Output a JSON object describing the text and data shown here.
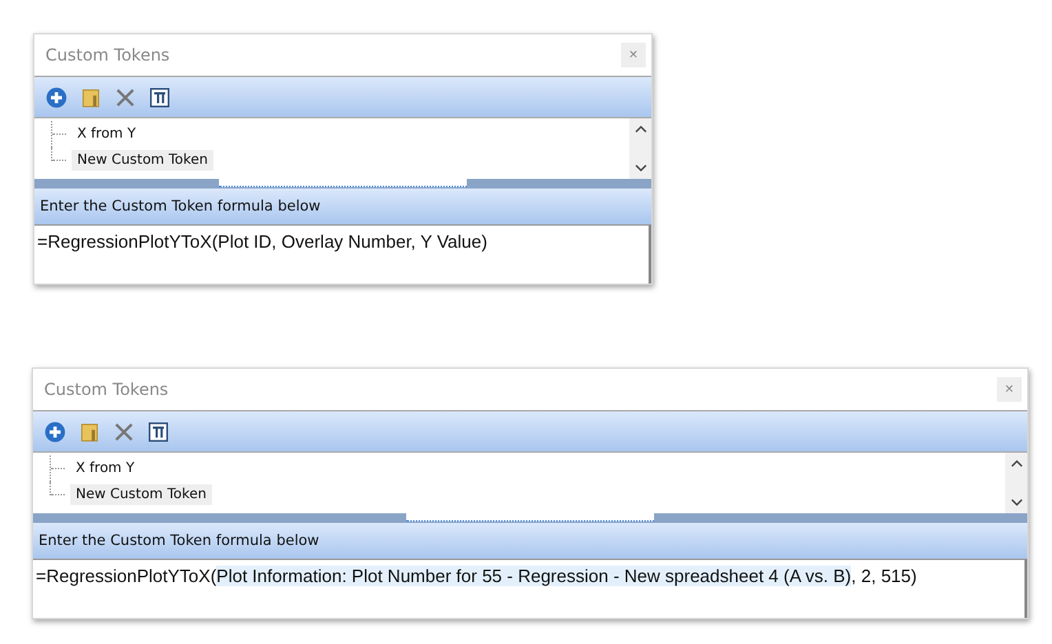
{
  "panels": [
    {
      "title": "Custom Tokens",
      "close": "×",
      "tree": [
        {
          "label": "X from Y",
          "selected": false
        },
        {
          "label": "New Custom Token",
          "selected": true
        }
      ],
      "formula_header": "Enter the Custom Token formula below",
      "formula": [
        {
          "text": "=RegressionPlotYToX(Plot ID, Overlay Number, Y Value)",
          "highlighted": false
        }
      ]
    },
    {
      "title": "Custom Tokens",
      "close": "×",
      "tree": [
        {
          "label": "X from Y",
          "selected": false
        },
        {
          "label": "New Custom Token",
          "selected": true
        }
      ],
      "formula_header": "Enter the Custom Token formula below",
      "formula": [
        {
          "text": "=RegressionPlotYToX(",
          "highlighted": false
        },
        {
          "text": "Plot Information: Plot Number for 55 - Regression - New spreadsheet 4 (A vs. B)",
          "highlighted": true
        },
        {
          "text": ", 2, 515)",
          "highlighted": false
        }
      ]
    }
  ]
}
